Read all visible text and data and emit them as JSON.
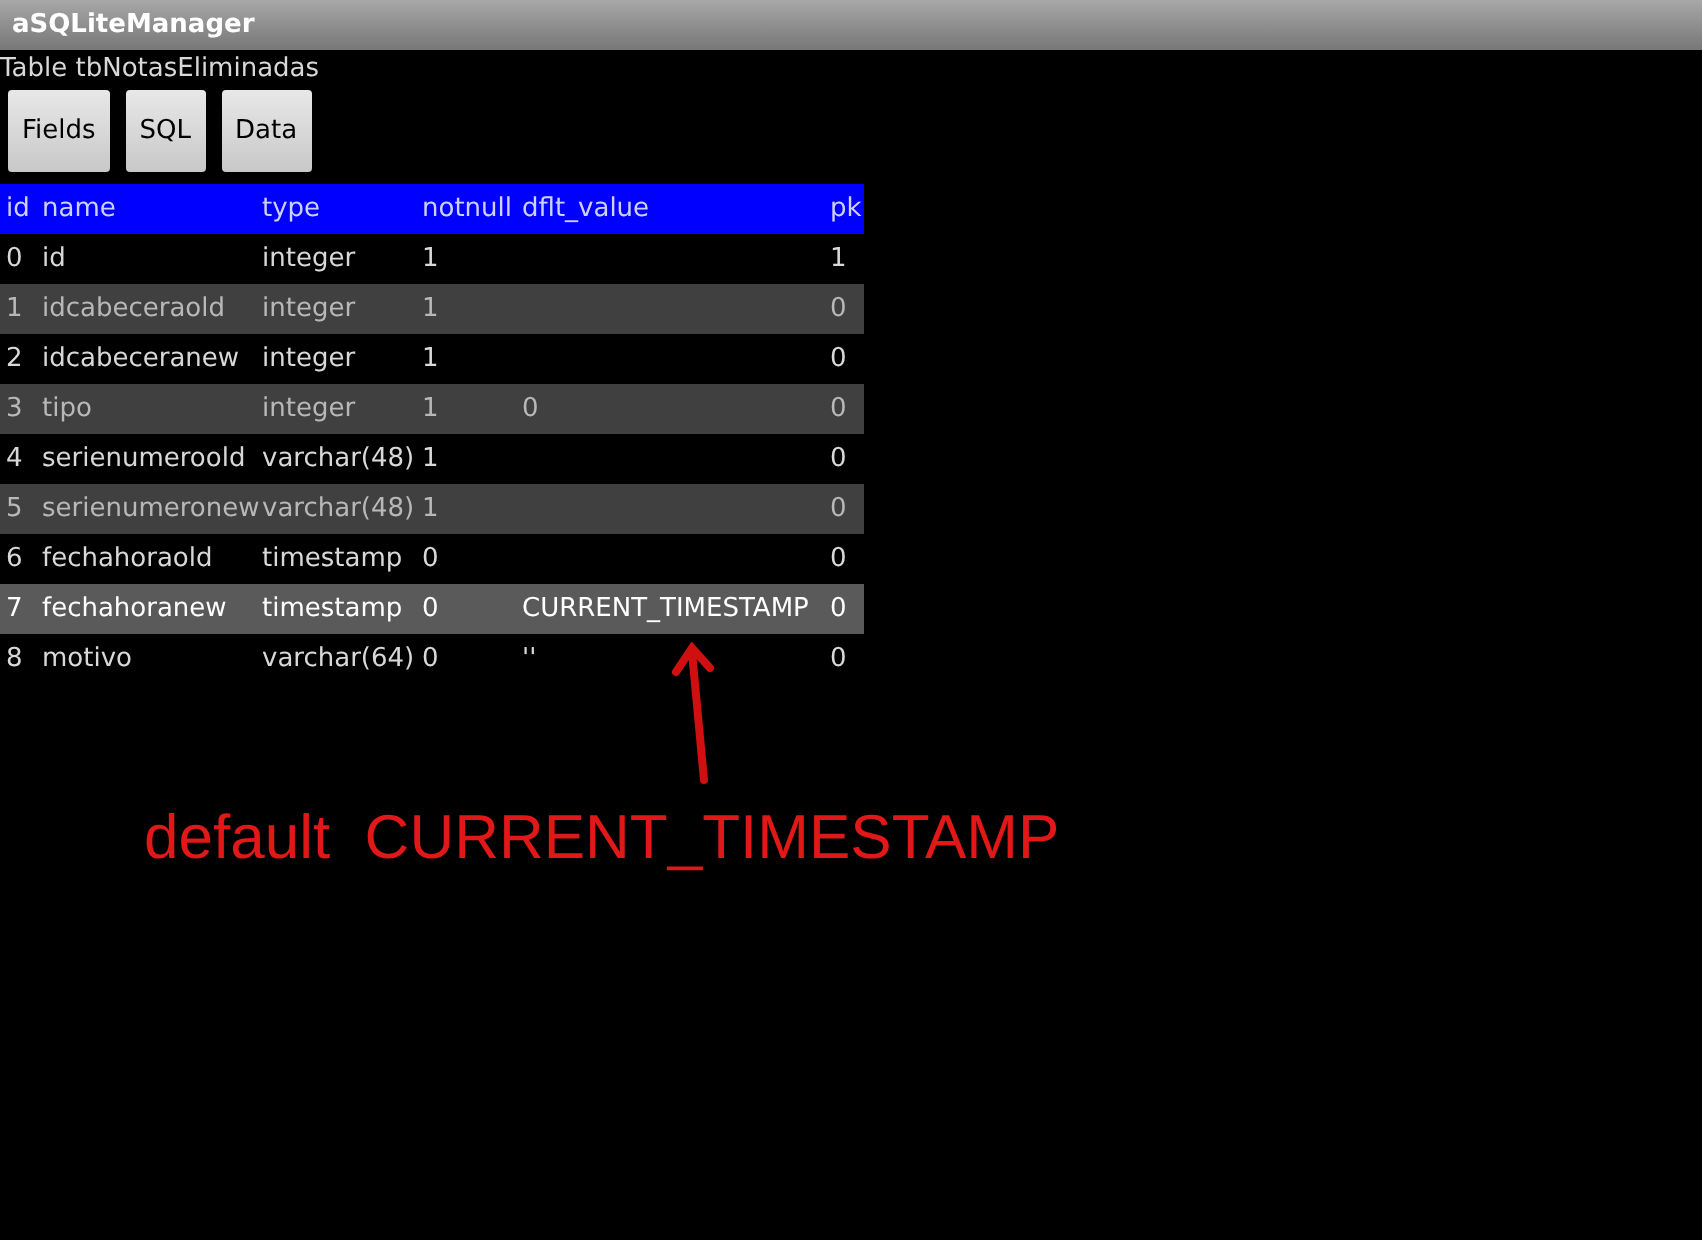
{
  "window": {
    "title": "aSQLiteManager"
  },
  "subtitle": "Table tbNotasEliminadas",
  "buttons": [
    {
      "label": "Fields"
    },
    {
      "label": "SQL"
    },
    {
      "label": "Data"
    }
  ],
  "table": {
    "columns": [
      "id",
      "name",
      "type",
      "notnull",
      "dflt_value",
      "pk"
    ],
    "rows": [
      {
        "cells": [
          "0",
          "id",
          "integer",
          "1",
          "",
          "1"
        ],
        "selected": false
      },
      {
        "cells": [
          "1",
          "idcabeceraold",
          "integer",
          "1",
          "",
          "0"
        ],
        "selected": false
      },
      {
        "cells": [
          "2",
          "idcabeceranew",
          "integer",
          "1",
          "",
          "0"
        ],
        "selected": false
      },
      {
        "cells": [
          "3",
          "tipo",
          "integer",
          "1",
          "0",
          "0"
        ],
        "selected": false
      },
      {
        "cells": [
          "4",
          "serienumeroold",
          "varchar(48)",
          "1",
          "",
          "0"
        ],
        "selected": false
      },
      {
        "cells": [
          "5",
          "serienumeronew",
          "varchar(48)",
          "1",
          "",
          "0"
        ],
        "selected": false
      },
      {
        "cells": [
          "6",
          "fechahoraold",
          "timestamp",
          "0",
          "",
          "0"
        ],
        "selected": false
      },
      {
        "cells": [
          "7",
          "fechahoranew",
          "timestamp",
          "0",
          "CURRENT_TIMESTAMP",
          "0"
        ],
        "selected": true
      },
      {
        "cells": [
          "8",
          "motivo",
          "varchar(64)",
          "0",
          "''",
          "0"
        ],
        "selected": false
      }
    ]
  },
  "annotation": {
    "text": "default  CURRENT_TIMESTAMP"
  }
}
